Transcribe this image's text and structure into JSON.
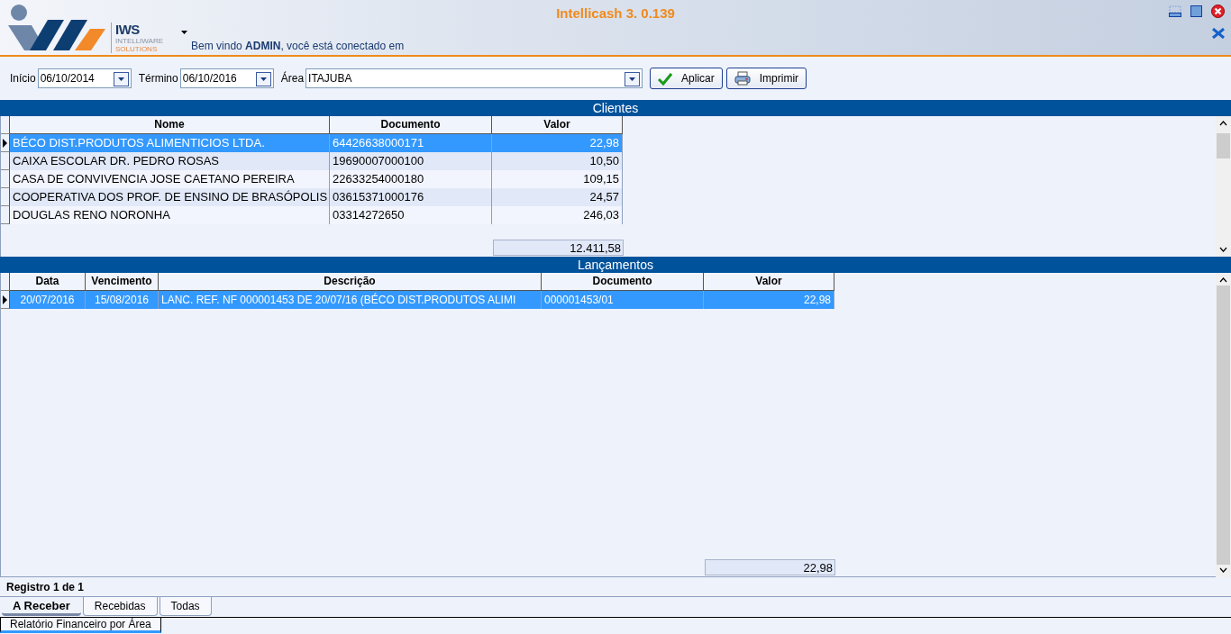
{
  "window": {
    "title": "Intellicash 3. 0.139"
  },
  "logo": {
    "name": "IWS",
    "line_1": "INTELLIWARE",
    "line_2": "SOLUTIONS"
  },
  "welcome": "Bem vindo **ADMIN**, você está conectado em",
  "filters": [
    {
      "label": "Início",
      "value": "06/10/2014",
      "kind": "date"
    },
    {
      "label": "Término",
      "value": "06/10/2016",
      "kind": "date"
    },
    {
      "label": "Área",
      "value": "ITAJUBA",
      "kind": "combo"
    }
  ],
  "buttons": [
    {
      "label": "Aplicar",
      "kind": "apply"
    },
    {
      "label": "Imprimir",
      "kind": "print"
    }
  ],
  "clients": {
    "title": "Clientes",
    "columns": [
      {
        "label": "Nome",
        "kind": "text"
      },
      {
        "label": "Documento",
        "kind": "text"
      },
      {
        "label": "Valor",
        "kind": "money"
      }
    ],
    "rows": [
      {
        "cells": [
          "BÉCO DIST.PRODUTOS ALIMENTICIOS LTDA.",
          "64426638000171",
          "22,98"
        ],
        "selected": true
      },
      {
        "cells": [
          "CAIXA ESCOLAR DR. PEDRO ROSAS",
          "19690007000100",
          "10,50"
        ],
        "selected": false
      },
      {
        "cells": [
          "CASA DE CONVIVENCIA JOSE CAETANO PEREIRA",
          "22633254000180",
          "109,15"
        ],
        "selected": false
      },
      {
        "cells": [
          "COOPERATIVA DOS PROF. DE ENSINO DE BRASÓPOLIS",
          "03615371000176",
          "24,57"
        ],
        "selected": false
      },
      {
        "cells": [
          "DOUGLAS RENO NORONHA",
          "03314272650",
          "246,03"
        ],
        "selected": false
      }
    ],
    "total": "12.411,58"
  },
  "entries": {
    "title": "Lançamentos",
    "columns": [
      {
        "label": "Data",
        "kind": "date"
      },
      {
        "label": "Vencimento",
        "kind": "date"
      },
      {
        "label": "Descrição",
        "kind": "text"
      },
      {
        "label": "Documento",
        "kind": "text"
      },
      {
        "label": "Valor",
        "kind": "money"
      }
    ],
    "rows": [
      {
        "cells": [
          "20/07/2016",
          "15/08/2016",
          "LANC. REF. NF 000001453 DE 20/07/16 (BÉCO DIST.PRODUTOS ALIMI",
          "000001453/01",
          "22,98"
        ],
        "selected": true
      }
    ],
    "total": "22,98"
  },
  "status": "Registro 1 de 1",
  "tabs": [
    {
      "label": "A Receber",
      "selected": true
    },
    {
      "label": "Recebidas",
      "selected": false
    },
    {
      "label": "Todas",
      "selected": false
    }
  ],
  "report_tabs": [
    {
      "label": "Relatório Financeiro por Área",
      "selected": true
    }
  ]
}
